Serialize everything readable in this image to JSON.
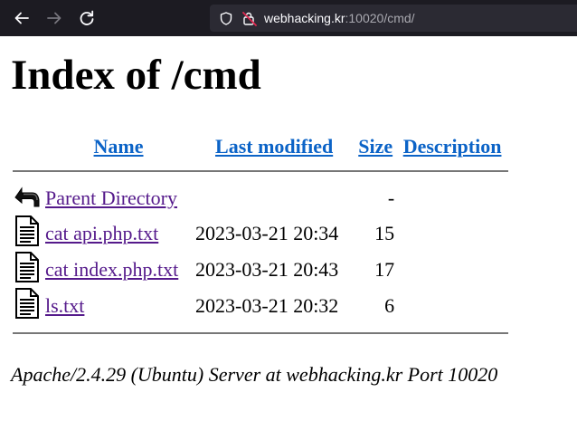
{
  "browser": {
    "url_host": "webhacking.kr",
    "url_path": ":10020/cmd/"
  },
  "page": {
    "title": "Index of /cmd",
    "columns": [
      "Name",
      "Last modified",
      "Size",
      "Description"
    ],
    "rows": [
      {
        "name": "Parent Directory",
        "modified": "",
        "size": "-",
        "icon": "back-arrow-icon"
      },
      {
        "name": "cat api.php.txt",
        "modified": "2023-03-21 20:34",
        "size": "15",
        "icon": "text-file-icon"
      },
      {
        "name": "cat index.php.txt",
        "modified": "2023-03-21 20:43",
        "size": "17",
        "icon": "text-file-icon"
      },
      {
        "name": "ls.txt",
        "modified": "2023-03-21 20:32",
        "size": "6",
        "icon": "text-file-icon"
      }
    ],
    "footer": "Apache/2.4.29 (Ubuntu) Server at webhacking.kr Port 10020"
  }
}
